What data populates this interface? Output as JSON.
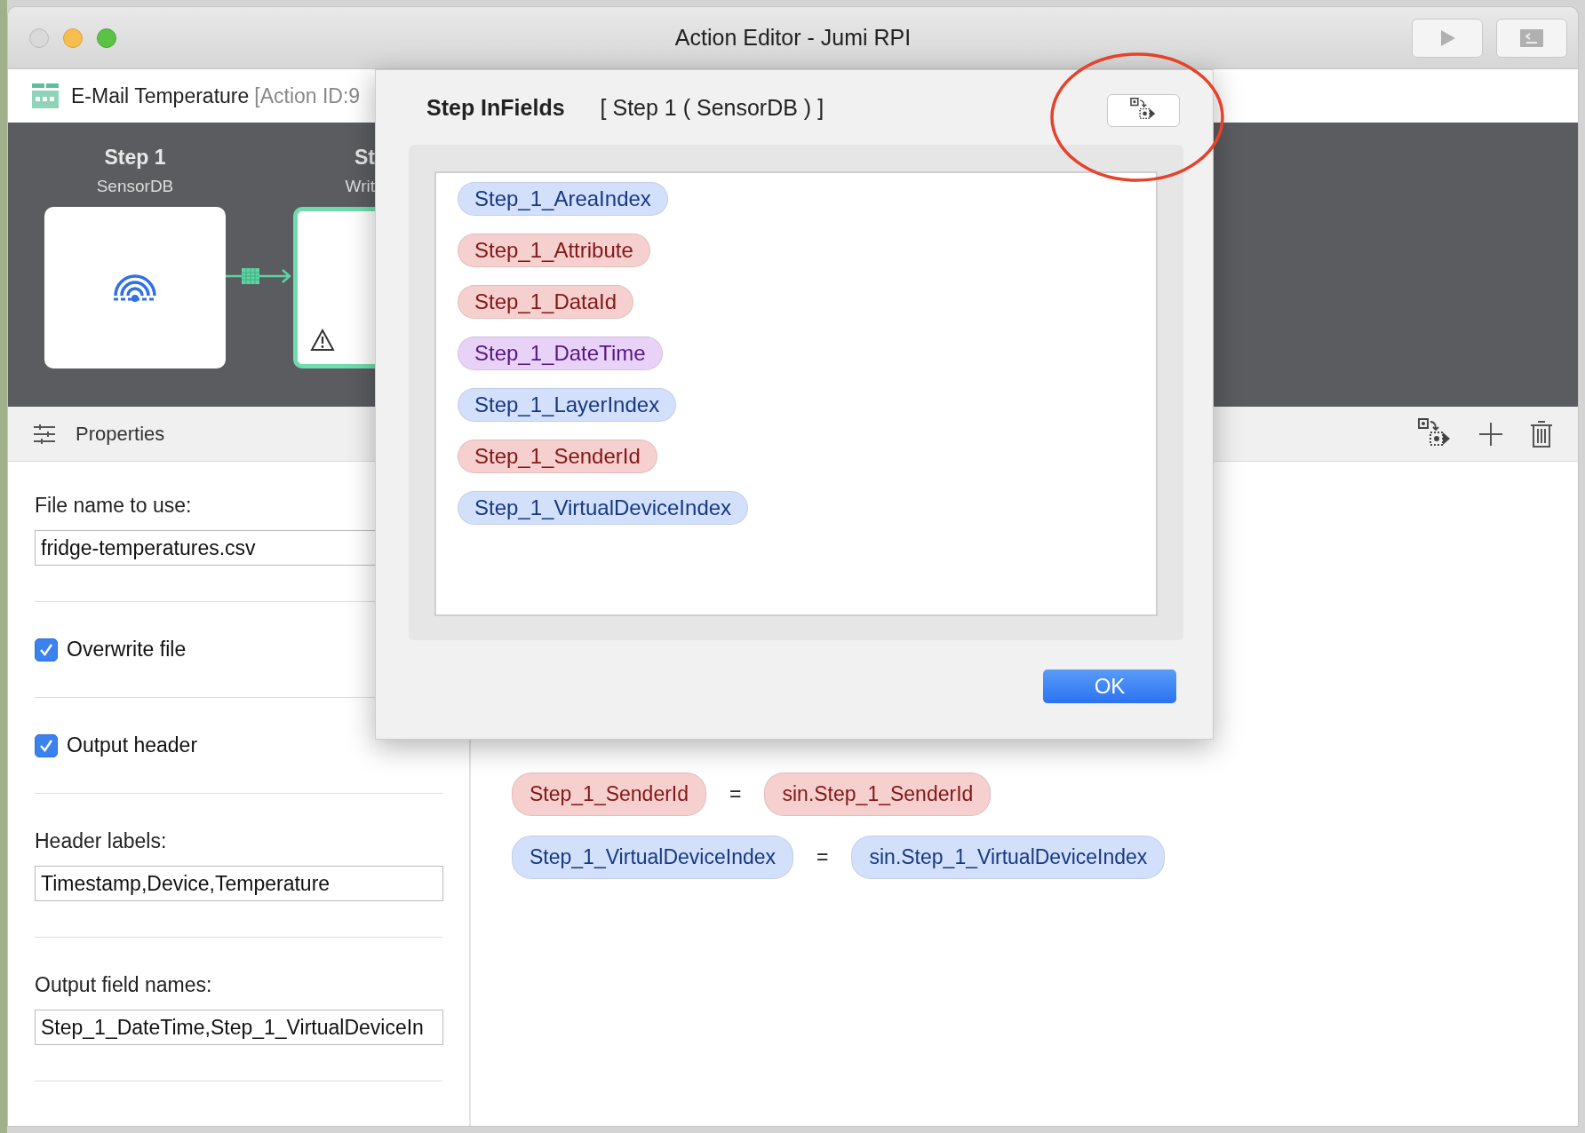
{
  "window": {
    "title": "Action Editor - Jumi RPI"
  },
  "action": {
    "name": "E-Mail Temperature",
    "id_label": "[Action ID:9"
  },
  "steps": [
    {
      "title": "Step 1",
      "type": "SensorDB",
      "selected": false,
      "warning": false
    },
    {
      "title": "St",
      "type": "Writ",
      "selected": true,
      "warning": true
    }
  ],
  "properties": {
    "title": "Properties",
    "fields": [
      {
        "kind": "text",
        "label": "File name to use:",
        "value": "fridge-temperatures.csv"
      },
      {
        "kind": "checkbox",
        "label": "Overwrite file",
        "checked": true
      },
      {
        "kind": "checkbox",
        "label": "Output header",
        "checked": true
      },
      {
        "kind": "text",
        "label": "Header labels:",
        "value": "Timestamp,Device,Temperature"
      },
      {
        "kind": "text",
        "label": "Output field names:",
        "value": "Step_1_DateTime,Step_1_VirtualDeviceIn"
      }
    ]
  },
  "mappings": [
    {
      "left": {
        "text": "Step_1_SenderId",
        "color": "#f6cfcf"
      },
      "operator": "=",
      "right": {
        "text": "sin.Step_1_SenderId",
        "color": "#f6cfcf"
      }
    },
    {
      "left": {
        "text": "Step_1_VirtualDeviceIndex",
        "color": "#d3e0fb"
      },
      "operator": "=",
      "right": {
        "text": "sin.Step_1_VirtualDeviceIndex",
        "color": "#d3e0fb"
      }
    }
  ],
  "dialog": {
    "title": "Step InFields",
    "subtitle": "[ Step 1 ( SensorDB ) ]",
    "highlighted": true,
    "fields": [
      {
        "name": "Step_1_AreaIndex",
        "color": "#d3e0fb"
      },
      {
        "name": "Step_1_Attribute",
        "color": "#f6cfcf"
      },
      {
        "name": "Step_1_DataId",
        "color": "#f6cfcf"
      },
      {
        "name": "Step_1_DateTime",
        "color": "#e8d2f7"
      },
      {
        "name": "Step_1_LayerIndex",
        "color": "#d3e0fb"
      },
      {
        "name": "Step_1_SenderId",
        "color": "#f6cfcf"
      },
      {
        "name": "Step_1_VirtualDeviceIndex",
        "color": "#d3e0fb"
      }
    ],
    "ok": "OK"
  }
}
